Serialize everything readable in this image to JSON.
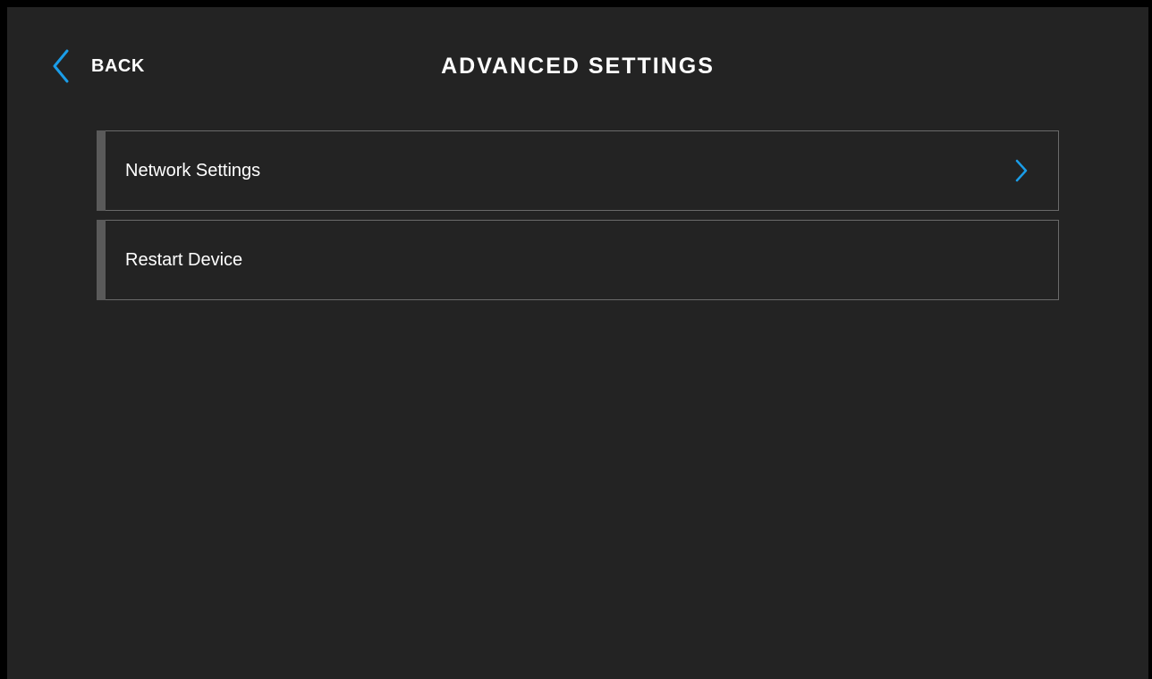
{
  "header": {
    "back_label": "BACK",
    "back_icon": "chevron-left-icon",
    "title": "ADVANCED SETTINGS"
  },
  "menu": {
    "items": [
      {
        "label": "Network Settings",
        "icon": "chevron-right-icon",
        "has_chevron": true
      },
      {
        "label": "Restart Device",
        "has_chevron": false
      }
    ]
  },
  "colors": {
    "background": "#232323",
    "frame": "#000000",
    "accent": "#1a9de8",
    "text": "#ffffff",
    "item_border": "#6a6a6a",
    "item_accent_bar": "#5a5a5a"
  }
}
